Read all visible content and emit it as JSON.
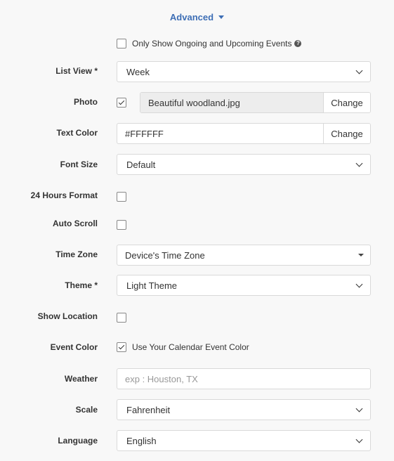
{
  "advanced": {
    "label": "Advanced"
  },
  "ongoing_only": {
    "label": "Only Show Ongoing and Upcoming Events",
    "checked": false,
    "help_icon": "question-circle-icon"
  },
  "list_view": {
    "label": "List View *",
    "value": "Week"
  },
  "photo": {
    "label": "Photo",
    "checked": true,
    "filename": "Beautiful woodland.jpg",
    "button": "Change"
  },
  "text_color": {
    "label": "Text Color",
    "value": "#FFFFFF",
    "button": "Change"
  },
  "font_size": {
    "label": "Font Size",
    "value": "Default"
  },
  "hours_24": {
    "label": "24 Hours Format",
    "checked": false
  },
  "auto_scroll": {
    "label": "Auto Scroll",
    "checked": false
  },
  "time_zone": {
    "label": "Time Zone",
    "value": "Device's Time Zone"
  },
  "theme": {
    "label": "Theme *",
    "value": "Light Theme"
  },
  "show_location": {
    "label": "Show Location",
    "checked": false
  },
  "event_color": {
    "label": "Event Color",
    "checked": true,
    "option_label": "Use Your Calendar Event Color"
  },
  "weather": {
    "label": "Weather",
    "placeholder": "exp : Houston, TX",
    "value": ""
  },
  "scale": {
    "label": "Scale",
    "value": "Fahrenheit"
  },
  "language": {
    "label": "Language",
    "value": "English"
  },
  "colors": {
    "accent": "#3d6eb5",
    "background": "#f8f8f8",
    "border": "#d9d9d9"
  }
}
